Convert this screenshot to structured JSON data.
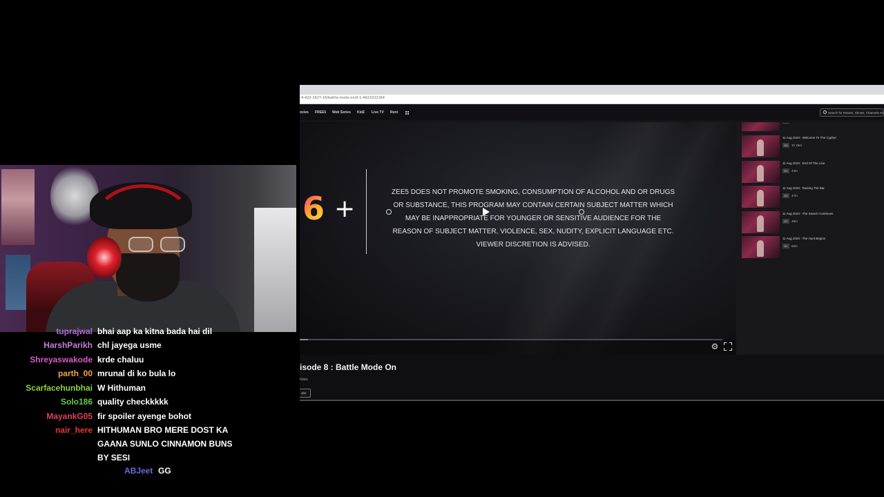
{
  "browser": {
    "url": "4-422-1627-16/battle-mode-on/0-1-4621022164",
    "nav_items": [
      "ovies",
      "FREE5",
      "Web Series",
      "KidZ",
      "Live TV",
      "Rent"
    ],
    "search_placeholder": "Search for Movies, Shows, Channels etc."
  },
  "player": {
    "age_number": "6",
    "age_plus": "+",
    "disclaimer": "ZEE5 DOES NOT PROMOTE SMOKING, CONSUMPTION OF ALCOHOL AND OR DRUGS OR SUBSTANCE, THIS PROGRAM MAY CONTAIN CERTAIN SUBJECT MATTER WHICH MAY BE INAPPROPRIATE FOR YOUNGER OR SENSITIVE AUDIENCE FOR THE REASON OF SUBJECT MATTER, VIOLENCE, SEX, NUDITY, EXPLICIT LANGUAGE ETC. VIEWER DISCRETION IS ADVISED.",
    "progress": 0.02,
    "settings_icon": "gear-icon",
    "fullscreen_icon": "fullscreen-icon"
  },
  "episodes": [
    {
      "title": "11 Aug 2020 : Welcome To The Cypher",
      "badge": "E5",
      "duration": "1h 15m"
    },
    {
      "title": "11 Aug 2020 : End Of The Line",
      "badge": "E4",
      "duration": "44m"
    },
    {
      "title": "11 Aug 2020 : Raising The Bar",
      "badge": "E3",
      "duration": "47m"
    },
    {
      "title": "11 Aug 2020 : The Search Continues",
      "badge": "E2",
      "duration": "48m"
    },
    {
      "title": "11 Aug 2020 : The Hunt Begins",
      "badge": "E1",
      "duration": "52m"
    }
  ],
  "below_player": {
    "heading": "isode 8 : Battle Mode On",
    "shows_link": "hows",
    "button_label": "olor"
  },
  "chat": [
    {
      "user": "tuprajwal",
      "color": "#b36ad9",
      "text": "bhai aap ka kitna bada hai dil"
    },
    {
      "user": "HarshParikh",
      "color": "#c77ee0",
      "text": "chl jayega usme"
    },
    {
      "user": "Shreyaswakode",
      "color": "#d65cc4",
      "text": "krde chaluu"
    },
    {
      "user": "parth_00",
      "color": "#f0a64a",
      "text": "mrunal di ko bula lo"
    },
    {
      "user": "Scarfacehunbhai",
      "color": "#8fd13c",
      "text": "W Hithuman"
    },
    {
      "user": "Solo186",
      "color": "#62cf44",
      "text": "quality checkkkkk"
    },
    {
      "user": "MayankG05",
      "color": "#e0405a",
      "text": "fir spoiler ayenge bohot"
    },
    {
      "user": "nair_here",
      "color": "#e23a3a",
      "text": "HITHUMAN BRO MERE DOST KA GAANA SUNLO CINNAMON BUNS BY SESI"
    },
    {
      "user": "ABJeet",
      "color": "#6a6ad6",
      "text": "GG"
    }
  ]
}
